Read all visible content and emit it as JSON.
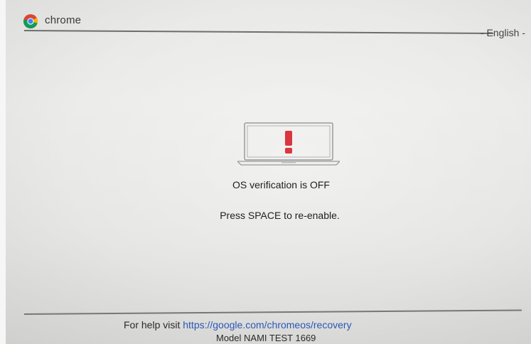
{
  "header": {
    "logo_icon": "chrome-logo-icon",
    "logo_text": "chrome",
    "language": "- English -"
  },
  "main": {
    "illustration_icon": "laptop-warning-icon",
    "warning_color": "#d9363e",
    "title": "OS verification is OFF",
    "instruction": "Press SPACE to re-enable."
  },
  "footer": {
    "help_prefix": "For help visit ",
    "help_url": "https://google.com/chromeos/recovery",
    "link_color": "#2a57b8",
    "model": "Model  NAMI TEST 1669"
  }
}
